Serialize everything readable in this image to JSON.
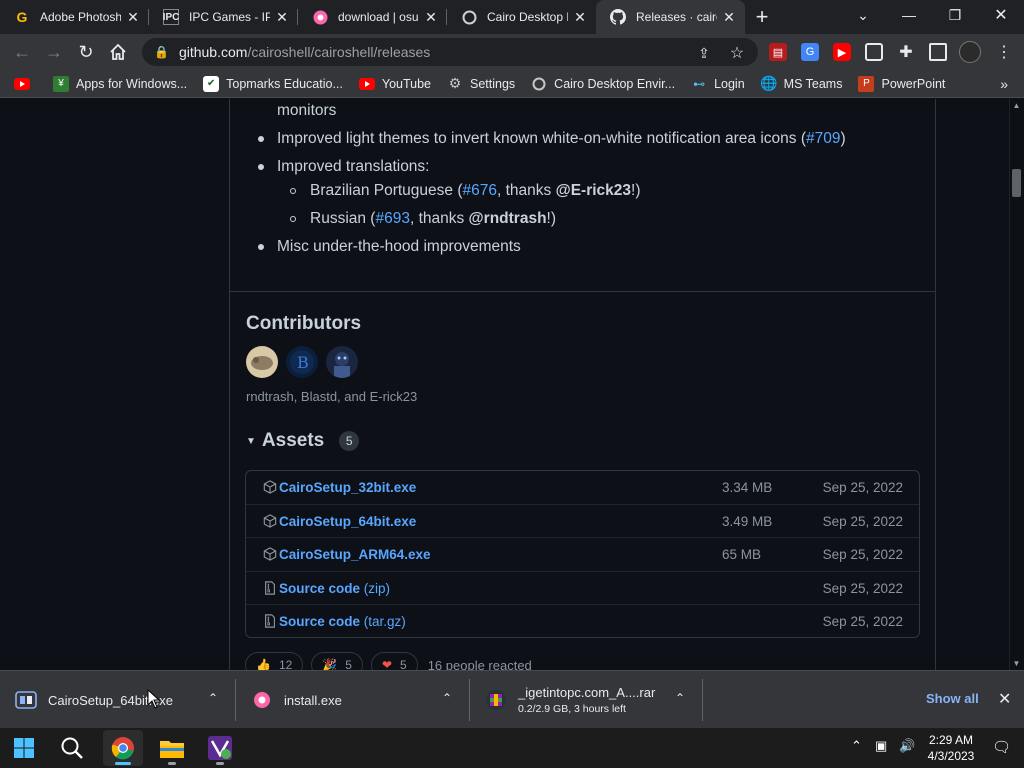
{
  "tabs": [
    {
      "title": "Adobe Photosh",
      "favicon": "G",
      "active": false
    },
    {
      "title": "IPC Games - IPC",
      "favicon": "IPC",
      "active": false
    },
    {
      "title": "download | osu!",
      "favicon": "osu-icon",
      "active": false
    },
    {
      "title": "Cairo Desktop E",
      "favicon": "cairo-icon",
      "active": false
    },
    {
      "title": "Releases · cairo",
      "favicon": "github-icon",
      "active": true
    }
  ],
  "toolbar": {
    "url_host": "github.com",
    "url_path": "/cairoshell/cairoshell/releases"
  },
  "bookmarks": [
    {
      "label": "",
      "icon": "youtube-icon"
    },
    {
      "label": "Apps for Windows...",
      "icon": "apps-icon"
    },
    {
      "label": "Topmarks Educatio...",
      "icon": "check-icon"
    },
    {
      "label": "YouTube",
      "icon": "youtube-icon"
    },
    {
      "label": "Settings",
      "icon": "gear-icon"
    },
    {
      "label": "Cairo Desktop Envir...",
      "icon": "cairo-icon"
    },
    {
      "label": "Login",
      "icon": "login-icon"
    },
    {
      "label": "MS Teams",
      "icon": "globe-icon"
    },
    {
      "label": "PowerPoint",
      "icon": "ppt-icon"
    }
  ],
  "release_notes": {
    "monitors_tail": "monitors",
    "item_light": "Improved light themes to invert known white-on-white notification area icons (",
    "item_light_link": "#709",
    "item_light_end": ")",
    "item_translations": "Improved translations:",
    "pt_label": "Brazilian Portuguese (",
    "pt_link": "#676",
    "pt_mid": ", thanks ",
    "pt_user": "@E-rick23",
    "pt_end": "!)",
    "ru_label": "Russian (",
    "ru_link": "#693",
    "ru_mid": ", thanks ",
    "ru_user": "@rndtrash",
    "ru_end": "!)",
    "item_misc": "Misc under-the-hood improvements"
  },
  "contributors": {
    "heading": "Contributors",
    "names": "rndtrash, Blastd, and E-rick23"
  },
  "assets": {
    "heading": "Assets",
    "count": "5",
    "rows": [
      {
        "name": "CairoSetup_32bit.exe",
        "suffix": "",
        "size": "3.34 MB",
        "date": "Sep 25, 2022",
        "icon": "package-icon"
      },
      {
        "name": "CairoSetup_64bit.exe",
        "suffix": "",
        "size": "3.49 MB",
        "date": "Sep 25, 2022",
        "icon": "package-icon"
      },
      {
        "name": "CairoSetup_ARM64.exe",
        "suffix": "",
        "size": "65 MB",
        "date": "Sep 25, 2022",
        "icon": "package-icon"
      },
      {
        "name": "Source code",
        "suffix": " (zip)",
        "size": "",
        "date": "Sep 25, 2022",
        "icon": "file-zip-icon"
      },
      {
        "name": "Source code",
        "suffix": " (tar.gz)",
        "size": "",
        "date": "Sep 25, 2022",
        "icon": "file-zip-icon"
      }
    ]
  },
  "reactions": {
    "items": [
      {
        "emoji": "👍",
        "count": "12"
      },
      {
        "emoji": "🎉",
        "count": "5"
      },
      {
        "emoji": "❤",
        "count": "5"
      }
    ],
    "summary": "16 people reacted"
  },
  "downloads": {
    "items": [
      {
        "name": "CairoSetup_64bit.exe",
        "sub": ""
      },
      {
        "name": "install.exe",
        "sub": ""
      },
      {
        "name": "_igetintopc.com_A....rar",
        "sub": "0.2/2.9 GB, 3 hours left"
      }
    ],
    "show_all": "Show all"
  },
  "taskbar": {
    "time": "2:29 AM",
    "date": "4/3/2023"
  },
  "colors": {
    "link": "#58a6ff",
    "text": "#c9d1d9",
    "muted": "#8b949e",
    "bg": "#0d1117",
    "border": "#30363d"
  }
}
